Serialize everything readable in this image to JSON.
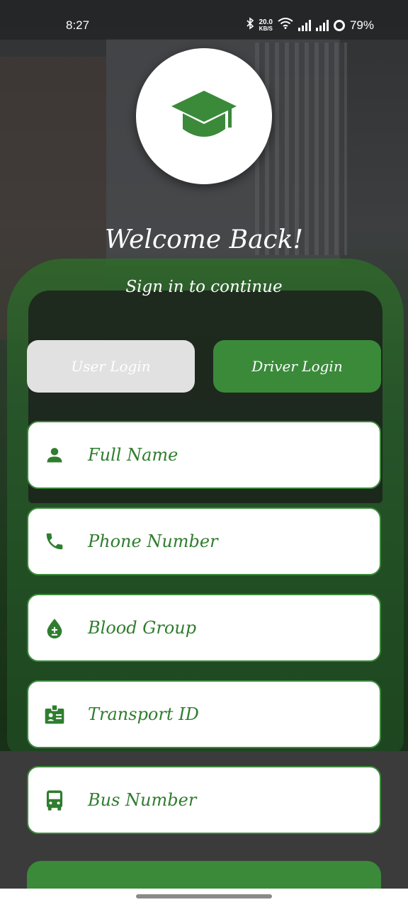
{
  "status": {
    "time": "8:27",
    "net_speed_value": "20.0",
    "net_speed_unit": "KB/S",
    "battery": "79%"
  },
  "header": {
    "logo_icon": "graduation-cap-icon",
    "title": "Welcome Back!",
    "subtitle": "Sign in to continue"
  },
  "login_toggle": {
    "user_label": "User Login",
    "driver_label": "Driver Login",
    "active": "Driver Login"
  },
  "form": {
    "fields": [
      {
        "icon": "person-icon",
        "placeholder": "Full Name"
      },
      {
        "icon": "phone-icon",
        "placeholder": "Phone Number"
      },
      {
        "icon": "blood-drop-icon",
        "placeholder": "Blood Group"
      },
      {
        "icon": "id-badge-icon",
        "placeholder": "Transport ID"
      },
      {
        "icon": "bus-icon",
        "placeholder": "Bus Number"
      }
    ]
  },
  "colors": {
    "primary_green": "#3a8a3a",
    "field_text_green": "#2f7d2f",
    "inactive_toggle": "#e1e1e1"
  }
}
